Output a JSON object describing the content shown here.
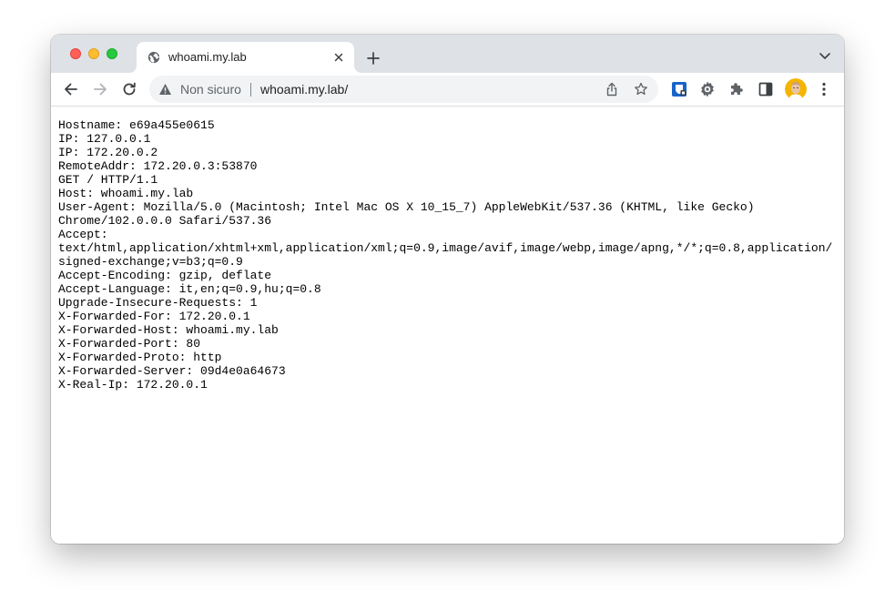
{
  "tab": {
    "title": "whoami.my.lab",
    "favicon_icon": "globe-icon"
  },
  "toolbar": {
    "security_label": "Non sicuro",
    "url": "whoami.my.lab/"
  },
  "response_lines": [
    "Hostname: e69a455e0615",
    "IP: 127.0.0.1",
    "IP: 172.20.0.2",
    "RemoteAddr: 172.20.0.3:53870",
    "GET / HTTP/1.1",
    "Host: whoami.my.lab",
    "User-Agent: Mozilla/5.0 (Macintosh; Intel Mac OS X 10_15_7) AppleWebKit/537.36 (KHTML, like Gecko)",
    "Chrome/102.0.0.0 Safari/537.36",
    "Accept:",
    "text/html,application/xhtml+xml,application/xml;q=0.9,image/avif,image/webp,image/apng,*/*;q=0.8,application/",
    "signed-exchange;v=b3;q=0.9",
    "Accept-Encoding: gzip, deflate",
    "Accept-Language: it,en;q=0.9,hu;q=0.8",
    "Upgrade-Insecure-Requests: 1",
    "X-Forwarded-For: 172.20.0.1",
    "X-Forwarded-Host: whoami.my.lab",
    "X-Forwarded-Port: 80",
    "X-Forwarded-Proto: http",
    "X-Forwarded-Server: 09d4e0a64673",
    "X-Real-Ip: 172.20.0.1"
  ]
}
